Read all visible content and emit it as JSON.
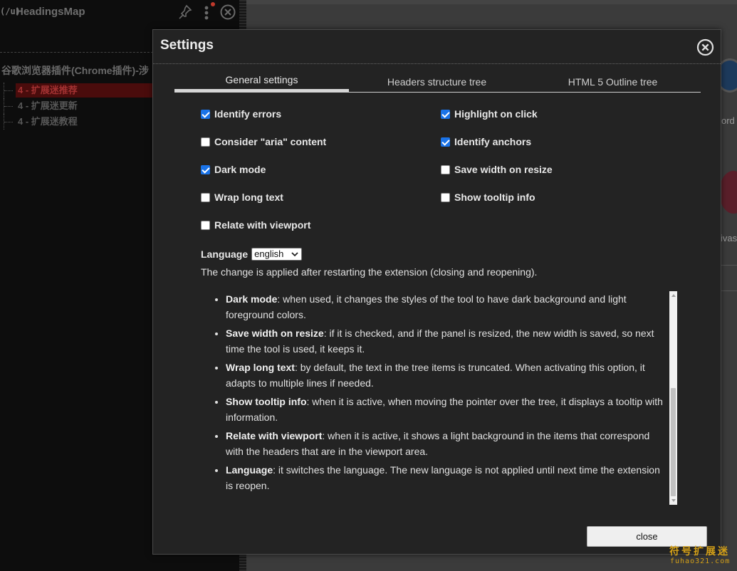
{
  "side_panel": {
    "logo": "(/u)",
    "title": "HeadingsMap",
    "page_heading": "谷歌浏览器插件(Chrome插件)-涉",
    "tree": [
      {
        "label": "4 - 扩展迷推荐",
        "selected": true
      },
      {
        "label": "4 - 扩展迷更新",
        "selected": false
      },
      {
        "label": "4 - 扩展迷教程",
        "selected": false
      }
    ]
  },
  "background": {
    "word1": "ord",
    "word2": "ivas"
  },
  "dialog": {
    "title": "Settings",
    "tabs": [
      {
        "label": "General settings",
        "active": true
      },
      {
        "label": "Headers structure tree",
        "active": false
      },
      {
        "label": "HTML 5 Outline tree",
        "active": false
      }
    ],
    "options_left": [
      {
        "label": "Identify errors",
        "checked": true
      },
      {
        "label": "Consider \"aria\" content",
        "checked": false
      },
      {
        "label": "Dark mode",
        "checked": true
      },
      {
        "label": "Wrap long text",
        "checked": false
      },
      {
        "label": "Relate with viewport",
        "checked": false
      }
    ],
    "options_right": [
      {
        "label": "Highlight on click",
        "checked": true
      },
      {
        "label": "Identify anchors",
        "checked": true
      },
      {
        "label": "Save width on resize",
        "checked": false
      },
      {
        "label": "Show tooltip info",
        "checked": false
      }
    ],
    "language": {
      "label": "Language",
      "selected": "english"
    },
    "note": "The change is applied after restarting the extension (closing and reopening).",
    "help": [
      {
        "term": "Dark mode",
        "text": ": when used, it changes the styles of the tool to have dark background and light foreground colors."
      },
      {
        "term": "Save width on resize",
        "text": ": if it is checked, and if the panel is resized, the new width is saved, so next time the tool is used, it keeps it."
      },
      {
        "term": "Wrap long text",
        "text": ": by default, the text in the tree items is truncated. When activating this option, it adapts to multiple lines if needed."
      },
      {
        "term": "Show tooltip info",
        "text": ": when it is active, when moving the pointer over the tree, it displays a tooltip with information."
      },
      {
        "term": "Relate with viewport",
        "text": ": when it is active, it shows a light background in the items that correspond with the headers that are in the viewport area."
      },
      {
        "term": "Language",
        "text": ": it switches the language. The new language is not applied until next time the extension is reopen."
      }
    ],
    "close_label": "close"
  },
  "watermark": {
    "cn": "符号扩展迷",
    "url": "fuhao321.com"
  },
  "colors": {
    "accent_checkbox": "#1a73e8",
    "dialog_bg": "#232323",
    "panel_bg": "#0d0d0d",
    "selected_item_bg": "#4a0c0c",
    "watermark": "#d4a017"
  },
  "icons": {
    "pin": "pin-icon",
    "menu": "kebab-menu-icon",
    "close": "close-circle-icon",
    "dropdown": "chevron-down-icon"
  }
}
